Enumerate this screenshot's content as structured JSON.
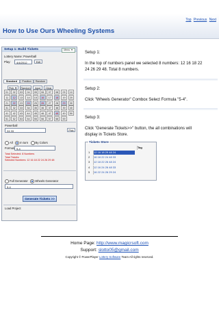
{
  "header": {
    "links": [
      "Top",
      "Previous",
      "Next"
    ],
    "title": "How to Use Ours Wheeling Systems"
  },
  "steps": {
    "s1_title": "Setup 1:",
    "s1_line1": "In the top of numbers panel we selected 8 numbers: 12 16 18 22",
    "s1_line2": "24 26 29 48. Total 8 numbers.",
    "s2_title": "Setup 2:",
    "s2_line1": "Click \"Wheels Generator\" Combox Select Formula \"5-4\".",
    "s3_title": "Setup 3:",
    "s3_line1": "Click \"Generate Tickets>>\" button, the all combinations will",
    "s3_line2": "display in Tickets Store."
  },
  "panel": {
    "title": "Setup 1: Build Tickets",
    "menu": "Menu ▼",
    "lottery_label": "Lottery Name: Powerball",
    "date_label": "Play:",
    "date_value": "4/4/2012",
    "edit": "Edit",
    "tabs": [
      "Standard",
      "Position",
      "Random"
    ],
    "buttons": [
      "Pick ▼",
      "Random",
      "Input",
      "Clear"
    ],
    "numbers": [
      "01",
      "02",
      "03",
      "04",
      "05",
      "06",
      "07",
      "08",
      "09",
      "10",
      "11",
      "12",
      "13",
      "14",
      "15",
      "16",
      "17",
      "18",
      "19",
      "20",
      "21",
      "22",
      "23",
      "24",
      "25",
      "26",
      "27",
      "28",
      "29",
      "30",
      "31",
      "32",
      "33",
      "34",
      "35",
      "36",
      "37",
      "38",
      "39",
      "40",
      "41",
      "42",
      "43",
      "44",
      "45",
      "46",
      "47",
      "48",
      "49",
      "50",
      "51",
      "52",
      "53",
      "54",
      "55",
      "56",
      "57",
      "58",
      "59"
    ],
    "powerball_label": "Powerball",
    "powerball_value": "24 33",
    "pick": "Pick",
    "all": "All",
    "in_turn": "In turn",
    "by_colors": "By Colors",
    "formula_label": "Formula",
    "formula_value": "5-4",
    "selected_1": "Total Selected: 8 Numbers",
    "selected_2": "Total Tickets:",
    "selected_3": "Selected Numbers: 12 16 18 22 24 26 29 48",
    "full_generator": "Full Generator",
    "wheels_generator": "Wheels Generator",
    "generate": "Generate Tickets >>",
    "load_project": "Load Project"
  },
  "tickets": {
    "title": "Tickets Store",
    "col_tag": "Tag",
    "rows": [
      {
        "n": "1",
        "v": "12 16 18 29 48 24"
      },
      {
        "n": "2",
        "v": "16 18 22 24 48 33"
      },
      {
        "n": "3",
        "v": "12 18 22 26 48 24"
      },
      {
        "n": "4",
        "v": "12 16 24 26 48 33"
      },
      {
        "n": "5",
        "v": "16 22 24 26 29 24"
      }
    ]
  },
  "footer": {
    "home_label": "Home Page:",
    "home_url": "http://www.magicrsoft.com",
    "support_label": "Support:",
    "support_email": "slotto05@gmail.com",
    "copyright_pre": "Copyright © PowerPlayer",
    "copyright_link": "Lottery Software",
    "copyright_post": "Team All rights reserved."
  },
  "colors": {
    "accent": "#1d4fa8",
    "link": "#1a4fb5",
    "highlight": "#2b58b8"
  }
}
